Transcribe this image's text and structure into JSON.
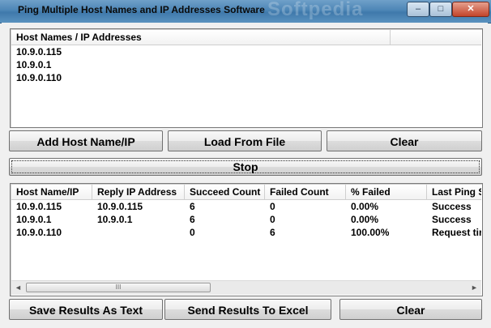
{
  "window": {
    "title": "Ping Multiple Host Names and IP Addresses Software",
    "watermark": "Softpedia",
    "minimize_glyph": "–",
    "maximize_glyph": "□",
    "close_glyph": "✕"
  },
  "hosts_list": {
    "header": "Host Names / IP Addresses",
    "items": [
      "10.9.0.115",
      "10.9.0.1",
      "10.9.0.110"
    ]
  },
  "buttons": {
    "add": "Add Host Name/IP",
    "load": "Load From File",
    "clear_top": "Clear",
    "stop": "Stop",
    "save_text": "Save Results As Text",
    "send_excel": "Send Results To Excel",
    "clear_bottom": "Clear"
  },
  "results": {
    "columns": [
      "Host Name/IP",
      "Reply IP Address",
      "Succeed Count",
      "Failed Count",
      "% Failed",
      "Last Ping S"
    ],
    "rows": [
      [
        "10.9.0.115",
        "10.9.0.115",
        "6",
        "0",
        "0.00%",
        "Success"
      ],
      [
        "10.9.0.1",
        "10.9.0.1",
        "6",
        "0",
        "0.00%",
        "Success"
      ],
      [
        "10.9.0.110",
        "",
        "0",
        "6",
        "100.00%",
        "Request tir"
      ]
    ],
    "scrollbar": {
      "left_arrow": "◄",
      "right_arrow": "►",
      "thumb_grip": "III"
    }
  }
}
